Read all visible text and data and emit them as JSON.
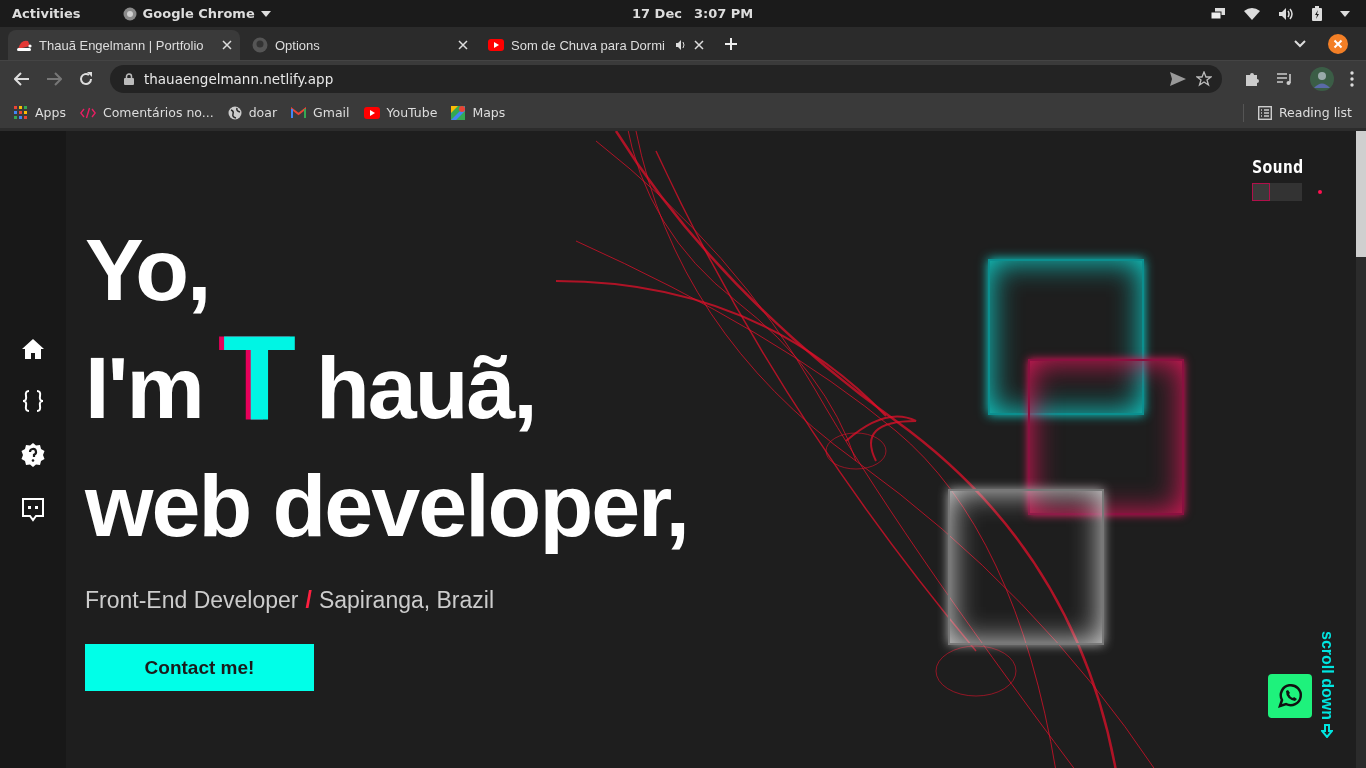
{
  "system_bar": {
    "activities": "Activities",
    "app": "Google Chrome",
    "date": "17 Dec",
    "time": "3:07 PM"
  },
  "tabs": [
    {
      "title": "Thauã Engelmann | Portfolio",
      "selected": true,
      "audio": false
    },
    {
      "title": "Options",
      "selected": false,
      "audio": false
    },
    {
      "title": "Som de Chuva para Dormi",
      "selected": false,
      "audio": true
    }
  ],
  "address": "thauaengelmann.netlify.app",
  "bookmarks": [
    {
      "label": "Apps"
    },
    {
      "label": "Comentários no..."
    },
    {
      "label": "doar"
    },
    {
      "label": "Gmail"
    },
    {
      "label": "YouTube"
    },
    {
      "label": "Maps"
    }
  ],
  "reading_list": "Reading list",
  "sound": {
    "label": "Sound",
    "on": false
  },
  "hero": {
    "line1": "Yo,",
    "line2_start": "I'm",
    "letter": "T",
    "line2_end": "hauã,",
    "line3": "web developer,",
    "role": "Front-End Developer",
    "separator": "/",
    "location": "Sapiranga, Brazil",
    "button": "Contact me!"
  },
  "scroll_hint": "scroll down"
}
